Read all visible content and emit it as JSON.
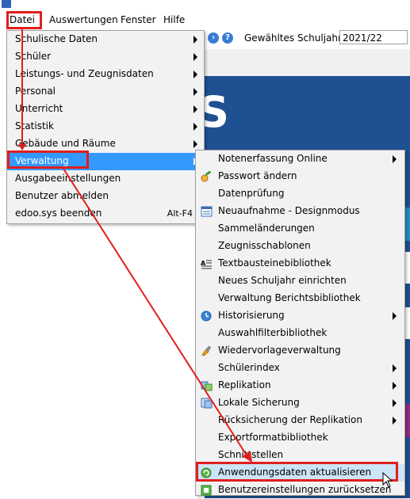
{
  "menubar": {
    "items": [
      "Datei",
      "Auswertungen",
      "Fenster",
      "Hilfe"
    ]
  },
  "toolbar": {
    "school_year_label": "Gewähltes Schuljahr",
    "school_year_value": "2021/22"
  },
  "datei_menu": {
    "items": [
      {
        "label": "Schulische Daten",
        "submenu": true
      },
      {
        "label": "Schüler",
        "submenu": true
      },
      {
        "label": "Leistungs- und Zeugnisdaten",
        "submenu": true
      },
      {
        "label": "Personal",
        "submenu": true
      },
      {
        "label": "Unterricht",
        "submenu": true
      },
      {
        "label": "Statistik",
        "submenu": true
      },
      {
        "label": "Gebäude und Räume",
        "submenu": true
      },
      {
        "label": "Verwaltung",
        "submenu": true
      },
      {
        "label": "Ausgabeeinstellungen",
        "submenu": false
      },
      {
        "label": "Benutzer abmelden",
        "submenu": false
      },
      {
        "label": "edoo.sys beenden",
        "submenu": false,
        "shortcut": "Alt-F4"
      }
    ]
  },
  "verwaltung_menu": {
    "items": [
      {
        "label": "Notenerfassung Online",
        "submenu": true,
        "icon": ""
      },
      {
        "label": "Passwort ändern",
        "submenu": false,
        "icon": "key-icon"
      },
      {
        "label": "Datenprüfung",
        "submenu": false,
        "icon": ""
      },
      {
        "label": "Neuaufnahme - Designmodus",
        "submenu": false,
        "icon": "form-icon"
      },
      {
        "label": "Sammeländerungen",
        "submenu": false,
        "icon": ""
      },
      {
        "label": "Zeugnisschablonen",
        "submenu": false,
        "icon": ""
      },
      {
        "label": "Textbausteinebibliothek",
        "submenu": false,
        "icon": "text-block-icon"
      },
      {
        "label": "Neues Schuljahr einrichten",
        "submenu": false,
        "icon": ""
      },
      {
        "label": "Verwaltung Berichtsbibliothek",
        "submenu": false,
        "icon": ""
      },
      {
        "label": "Historisierung",
        "submenu": true,
        "icon": "clock-icon"
      },
      {
        "label": "Auswahlfilterbibliothek",
        "submenu": false,
        "icon": ""
      },
      {
        "label": "Wiedervorlageverwaltung",
        "submenu": false,
        "icon": "brush-icon"
      },
      {
        "label": "Schülerindex",
        "submenu": true,
        "icon": ""
      },
      {
        "label": "Replikation",
        "submenu": true,
        "icon": "replication-icon"
      },
      {
        "label": "Lokale Sicherung",
        "submenu": true,
        "icon": "backup-icon"
      },
      {
        "label": "Rücksicherung der Replikation",
        "submenu": true,
        "icon": ""
      },
      {
        "label": "Exportformatbibliothek",
        "submenu": false,
        "icon": ""
      },
      {
        "label": "Schnittstellen",
        "submenu": false,
        "icon": ""
      },
      {
        "label": "Anwendungsdaten aktualisieren",
        "submenu": false,
        "icon": "refresh-icon"
      },
      {
        "label": "Benutzereinstellungen zurücksetzen",
        "submenu": false,
        "icon": "reset-settings-icon"
      }
    ]
  },
  "colors": {
    "selection": "#3399ff",
    "hover": "#cce4f7",
    "annotation_red": "#e21e1e",
    "background_blue": "#1f5092"
  }
}
